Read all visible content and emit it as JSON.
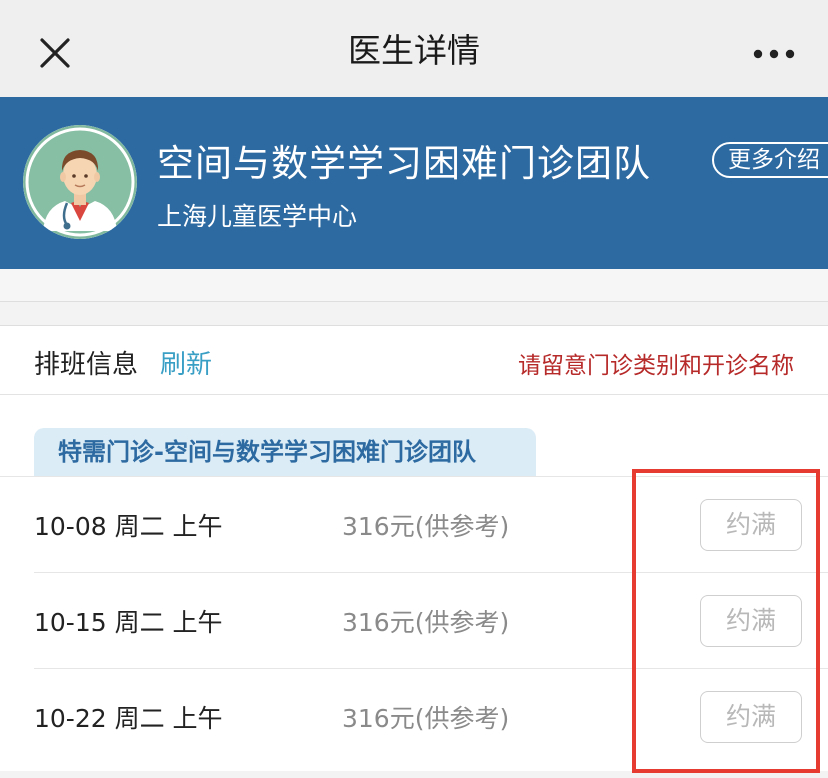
{
  "navbar": {
    "title": "医生详情",
    "close_icon": "close-icon",
    "more_icon": "more-dots-icon"
  },
  "header": {
    "team_name": "空间与数学学习困难门诊团队",
    "hospital": "上海儿童医学中心",
    "more_button": "更多介绍",
    "avatar_icon": "doctor-avatar-icon",
    "bg_color": "#2d6aa1"
  },
  "schedule": {
    "label": "排班信息",
    "refresh": "刷新",
    "notice": "请留意门诊类别和开诊名称",
    "clinic": "特需门诊-空间与数学学习困难门诊团队",
    "rows": [
      {
        "date": "10-08 周二 上午",
        "price": "316元(供参考)",
        "status": "约满"
      },
      {
        "date": "10-15 周二 上午",
        "price": "316元(供参考)",
        "status": "约满"
      },
      {
        "date": "10-22 周二 上午",
        "price": "316元(供参考)",
        "status": "约满"
      }
    ]
  },
  "colors": {
    "accent_link": "#3a9fc5",
    "notice": "#b72a2a",
    "highlight_box": "#e53b31"
  }
}
